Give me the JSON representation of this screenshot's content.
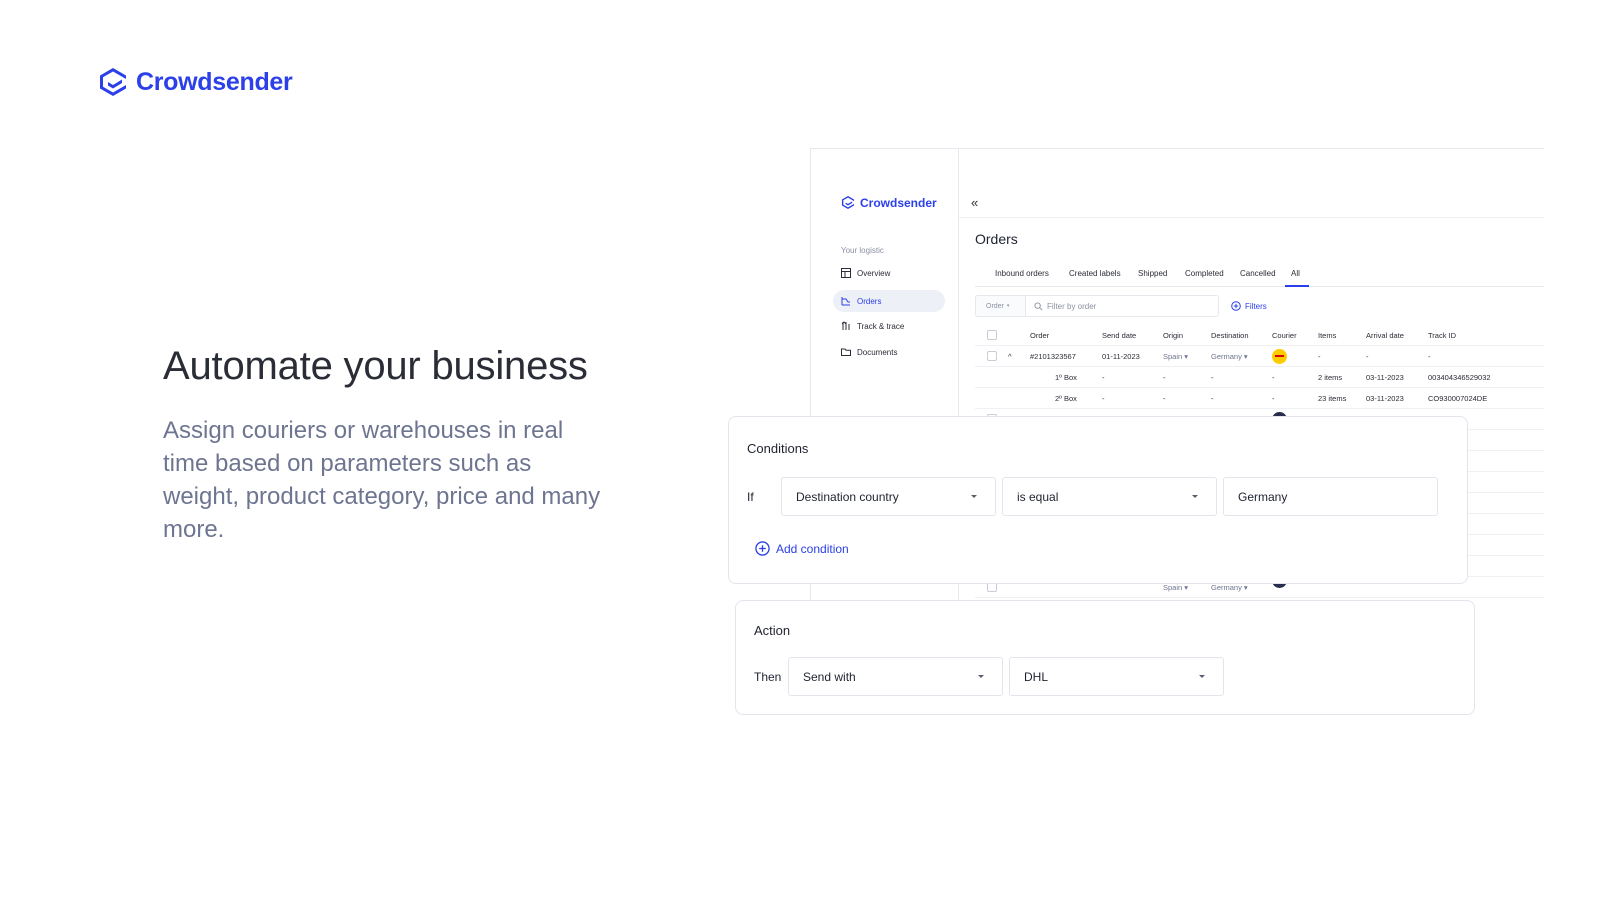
{
  "brand": {
    "name": "Crowdsender",
    "color": "#2b40e8",
    "logo_icon": "crowdsender-logo-icon"
  },
  "hero": {
    "title": "Automate your business",
    "description": "Assign couriers or warehouses in real time based on parameters such as weight, product category, price and many more."
  },
  "app": {
    "sidebar": {
      "brand_name": "Crowdsender",
      "section_label": "Your logistic",
      "items": [
        {
          "label": "Overview",
          "icon": "layout-icon"
        },
        {
          "label": "Orders",
          "icon": "orders-icon"
        },
        {
          "label": "Track & trace",
          "icon": "track-icon"
        },
        {
          "label": "Documents",
          "icon": "folder-icon"
        }
      ]
    },
    "collapse_glyph": "«",
    "page_title": "Orders",
    "tabs": [
      "Inbound orders",
      "Created labels",
      "Shipped",
      "Completed",
      "Cancelled",
      "All"
    ],
    "filter": {
      "order_select": "Order",
      "placeholder": "Filter by order",
      "filters_label": "Filters"
    },
    "table": {
      "headers": [
        "Order",
        "Send date",
        "Origin",
        "Destination",
        "Courier",
        "Items",
        "Arrival date",
        "Track ID"
      ],
      "rows": [
        {
          "order": "#2101323567",
          "send_date": "01-11-2023",
          "origin": "Spain",
          "destination": "Germany",
          "courier": "dhl",
          "items": "-",
          "arrival": "-",
          "track": "-"
        },
        {
          "order": "1º Box",
          "send_date": "-",
          "origin": "-",
          "destination": "-",
          "courier": "-",
          "items": "2 items",
          "arrival": "03-11-2023",
          "track": "003404346529032"
        },
        {
          "order": "2º Box",
          "send_date": "-",
          "origin": "-",
          "destination": "-",
          "courier": "-",
          "items": "23 items",
          "arrival": "03-11-2023",
          "track": "CO930007024DE"
        }
      ],
      "partial_row": {
        "origin": "Spain",
        "destination": "Germany"
      }
    }
  },
  "conditions": {
    "title": "Conditions",
    "if_label": "If",
    "field": "Destination country",
    "operator": "is equal",
    "value": "Germany",
    "add_label": "Add condition"
  },
  "action": {
    "title": "Action",
    "then_label": "Then",
    "method": "Send with",
    "courier": "DHL"
  }
}
